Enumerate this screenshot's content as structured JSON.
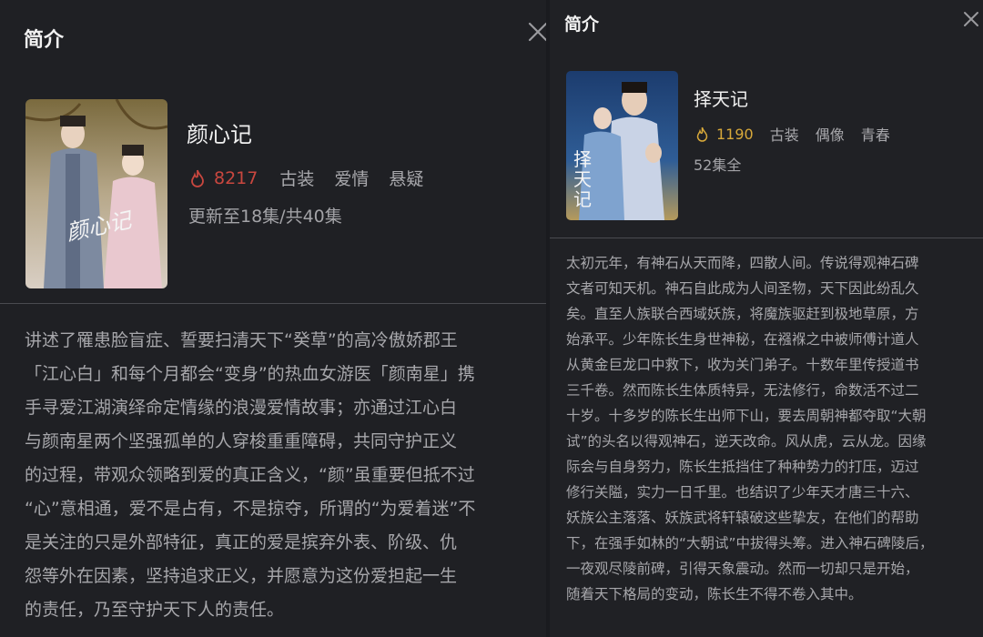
{
  "left": {
    "title": "简介",
    "show_name": "颜心记",
    "heat": "8217",
    "tags": [
      "古装",
      "爱情",
      "悬疑"
    ],
    "episodes": "更新至18集/共40集",
    "poster_text": "颜心记",
    "description_lines": [
      "讲述了罹患脸盲症、誓要扫清天下“癸草”的高冷傲娇郡王",
      "「江心白」和每个月都会“变身”的热血女游医「颜南星」携",
      "手寻爱江湖演绎命定情缘的浪漫爱情故事；亦通过江心白",
      "与颜南星两个坚强孤单的人穿梭重重障碍，共同守护正义",
      "的过程，带观众领略到爱的真正含义，“颜”虽重要但抵不过",
      "“心”意相通，爱不是占有，不是掠夺，所谓的“为爱着迷”不",
      "是关注的只是外部特征，真正的爱是摈弃外表、阶级、仇",
      "怨等外在因素，坚持追求正义，并愿意为这份爱担起一生",
      "的责任，乃至守护天下人的责任。"
    ]
  },
  "right": {
    "title": "简介",
    "show_name": "择天记",
    "heat": "1190",
    "tags": [
      "古装",
      "偶像",
      "青春"
    ],
    "episodes": "52集全",
    "poster_text": "择天记",
    "description_lines": [
      "太初元年，有神石从天而降，四散人间。传说得观神石碑",
      "文者可知天机。神石自此成为人间圣物，天下因此纷乱久",
      "矣。直至人族联合西域妖族，将魔族驱赶到极地草原，方",
      "始承平。少年陈长生身世神秘，在襁褓之中被师傅计道人",
      "从黄金巨龙口中救下，收为关门弟子。十数年里传授道书",
      "三千卷。然而陈长生体质特异，无法修行，命数活不过二",
      "十岁。十多岁的陈长生出师下山，要去周朝神都夺取“大朝",
      "试”的头名以得观神石，逆天改命。风从虎，云从龙。因缘",
      "际会与自身努力，陈长生抵挡住了种种势力的打压，迈过",
      "修行关隘，实力一日千里。也结识了少年天才唐三十六、",
      "妖族公主落落、妖族武将轩辕破这些挚友，在他们的帮助",
      "下，在强手如林的“大朝试”中拔得头筹。进入神石碑陵后，",
      "一夜观尽陵前碑，引得天象震动。然而一切却只是开始，",
      "随着天下格局的变动，陈长生不得不卷入其中。"
    ]
  },
  "icons": {
    "left_close": "close-icon",
    "right_close": "close-icon",
    "heat": "flame-icon"
  },
  "colors": {
    "heat_left": "#c9473f",
    "heat_right": "#d8a93a"
  }
}
